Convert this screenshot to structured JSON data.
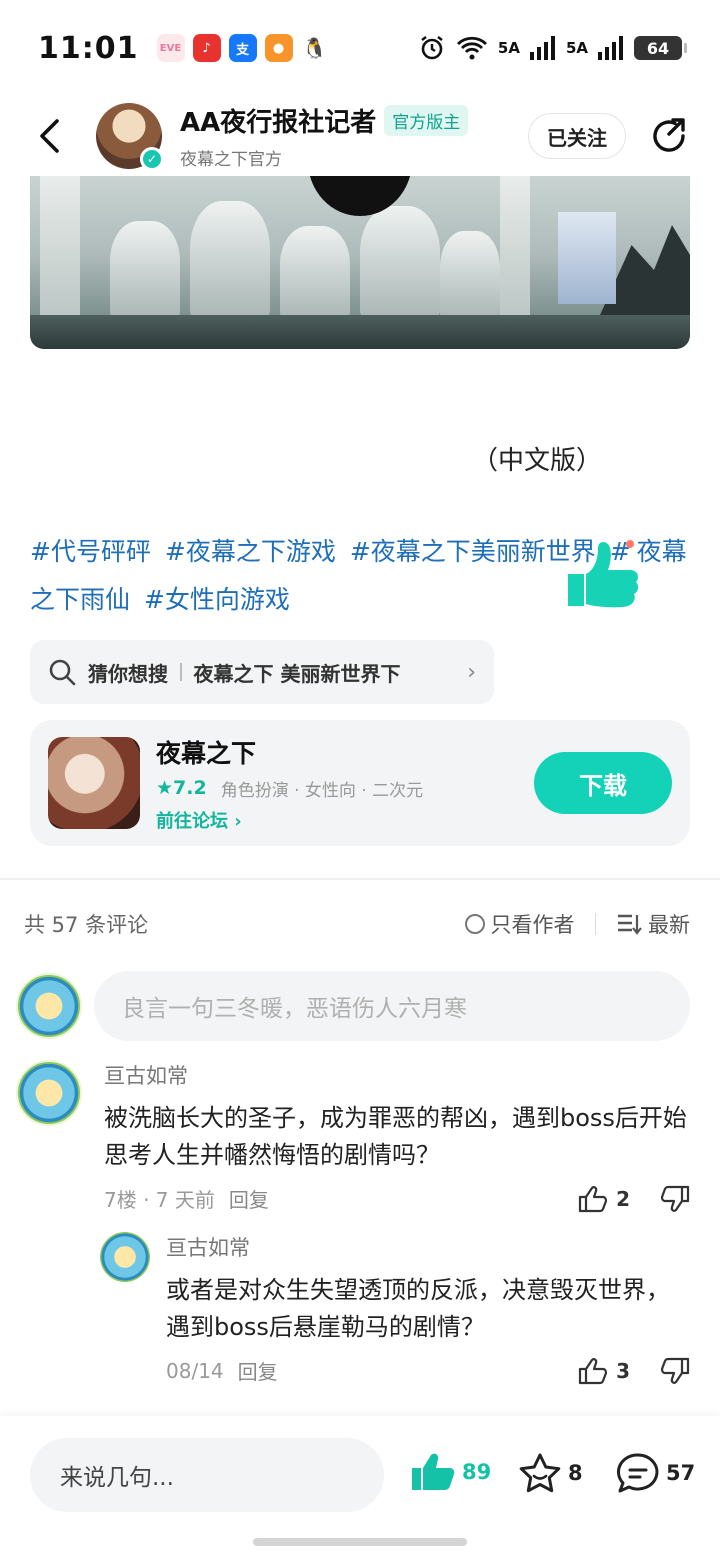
{
  "status_bar": {
    "time": "11:01",
    "signal1": "5A",
    "signal2": "5A",
    "battery": "64"
  },
  "header": {
    "author_name": "AA夜行报社记者",
    "author_tag": "官方版主",
    "author_sub": "夜幕之下官方",
    "follow_label": "已关注"
  },
  "post": {
    "subtitle": "（中文版）",
    "hashtags": [
      "#代号砰砰",
      "#夜幕之下游戏",
      "#夜幕之下美丽新世界",
      "#",
      "夜幕之下雨仙",
      "#女性向游戏"
    ]
  },
  "search_suggest": {
    "label": "猜你想搜",
    "query": "夜幕之下 美丽新世界下"
  },
  "game_card": {
    "name": "夜幕之下",
    "rating": "7.2",
    "tags": "角色扮演 · 女性向 · 二次元",
    "forum_link": "前往论坛",
    "download_label": "下载"
  },
  "comments": {
    "count_text": "共 57 条评论",
    "author_only": "只看作者",
    "sort_label": "最新",
    "input_placeholder": "良言一句三冬暖，恶语伤人六月寒",
    "items": [
      {
        "user": "亘古如常",
        "text": "被洗脑长大的圣子，成为罪恶的帮凶，遇到boss后开始思考人生并幡然悔悟的剧情吗？",
        "meta": "7楼 · 7 天前",
        "reply_label": "回复",
        "likes": "2"
      }
    ],
    "replies": [
      {
        "user": "亘古如常",
        "text": "或者是对众生失望透顶的反派，决意毁灭世界，遇到boss后悬崖勒马的剧情？",
        "meta": "08/14",
        "reply_label": "回复",
        "likes": "3"
      }
    ]
  },
  "bottom_bar": {
    "input_placeholder": "来说几句...",
    "likes": "89",
    "favorites": "8",
    "comments": "57"
  },
  "colors": {
    "accent": "#14d2b8",
    "hashtag": "#1f6fb8",
    "like_active": "#14c2a8"
  }
}
